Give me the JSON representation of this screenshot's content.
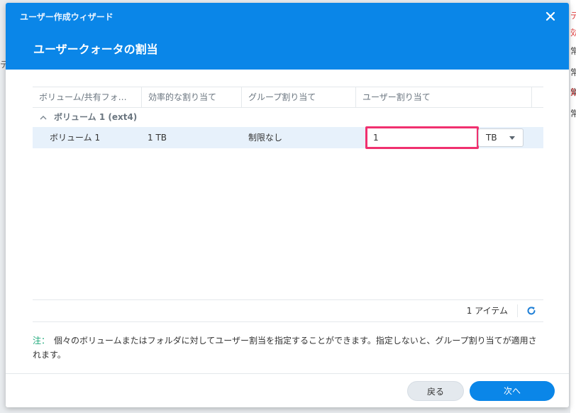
{
  "background": {
    "right_fragments": [
      {
        "text": "デ",
        "color": "#e03b3b"
      },
      {
        "text": "効",
        "color": "#e03b3b"
      },
      {
        "text": "常",
        "color": "#555555"
      },
      {
        "text": "常",
        "color": "#555555"
      },
      {
        "text": "常",
        "color": "#555555"
      },
      {
        "text": "効",
        "color": "#e03b3b"
      },
      {
        "text": "常",
        "color": "#555555"
      }
    ],
    "left_fragment": "デ"
  },
  "dialog": {
    "wizard_title": "ユーザー作成ウィザード",
    "close_icon": "close-icon",
    "page_title": "ユーザークォータの割当"
  },
  "grid": {
    "columns": [
      "ボリューム/共有フォ…",
      "効率的な割り当て",
      "グループ割り当て",
      "ユーザー割り当て"
    ],
    "group": {
      "icon": "chevron-up-icon",
      "label": "ボリューム 1 (ext4)"
    },
    "rows": [
      {
        "name": "ボリューム 1",
        "effective": "1 TB",
        "group_quota": "制限なし",
        "user_quota_value": "1",
        "unit": "TB"
      }
    ]
  },
  "footer": {
    "item_count": "1 アイテム",
    "refresh_icon": "refresh-icon"
  },
  "note": {
    "label": "注：",
    "text": "個々のボリュームまたはフォルダに対してユーザー割当を指定することができます。指定しないと、グループ割り当てが適用されます。"
  },
  "buttons": {
    "back": "戻る",
    "next": "次へ"
  },
  "colors": {
    "header": "#0a86e8",
    "highlight_border": "#f0306f",
    "selected_row": "#e7f1fb",
    "note_label": "#1fa97a"
  }
}
